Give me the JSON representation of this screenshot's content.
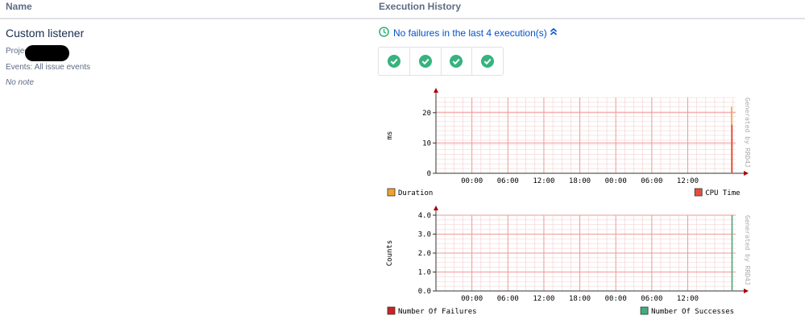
{
  "table": {
    "col_name": "Name",
    "col_history": "Execution History"
  },
  "listener": {
    "name": "Custom listener",
    "project_label": "Project",
    "events": "Events: All issue events",
    "note": "No note"
  },
  "history": {
    "summary": "No failures in the last 4 execution(s)",
    "executions": [
      "success",
      "success",
      "success",
      "success"
    ],
    "success_color": "#36b37e",
    "link_color": "#0052cc"
  },
  "chart_data": [
    {
      "type": "line",
      "ylabel": "ms",
      "watermark": "Generated by RRD4J",
      "x_ticks": [
        "00:00",
        "06:00",
        "12:00",
        "18:00",
        "00:00",
        "06:00",
        "12:00"
      ],
      "y_ticks": [
        "0",
        "10",
        "20"
      ],
      "ylim": [
        0,
        25
      ],
      "series": [
        {
          "name": "Duration",
          "color": "#f2a12e",
          "spike_at_hours": 49.3,
          "value": 22
        },
        {
          "name": "CPU Time",
          "color": "#e74c3c",
          "spike_at_hours": 49.3,
          "value": 16
        }
      ],
      "legend": [
        "Duration",
        "CPU Time"
      ]
    },
    {
      "type": "line",
      "ylabel": "Counts",
      "watermark": "Generated by RRD4J",
      "x_ticks": [
        "00:00",
        "06:00",
        "12:00",
        "18:00",
        "00:00",
        "06:00",
        "12:00"
      ],
      "y_ticks": [
        "0.0",
        "1.0",
        "2.0",
        "3.0",
        "4.0"
      ],
      "ylim": [
        0,
        4
      ],
      "series": [
        {
          "name": "Number Of Failures",
          "color": "#cc2222",
          "spike_at_hours": null,
          "value": 0
        },
        {
          "name": "Number Of Successes",
          "color": "#3fae7a",
          "spike_at_hours": 49.3,
          "value": 4
        }
      ],
      "legend": [
        "Number Of Failures",
        "Number Of Successes"
      ]
    }
  ]
}
